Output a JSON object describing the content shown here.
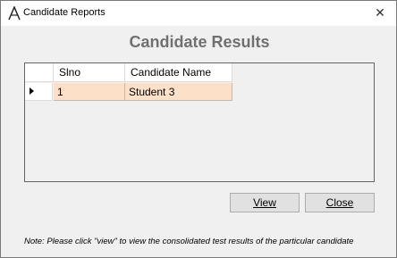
{
  "window": {
    "title": "Candidate Reports",
    "close_glyph": "✕",
    "icon": "app-logo-icon"
  },
  "heading": "Candidate Results",
  "grid": {
    "columns": [
      "Slno",
      "Candidate Name"
    ],
    "rows": [
      {
        "slno": "1",
        "name": "Student 3",
        "selected": true
      }
    ],
    "selected_row_color": "#fde0c8"
  },
  "buttons": {
    "view": "View",
    "close": "Close"
  },
  "note": "Note: Please click \"view\" to view the consolidated test results of the particular candidate"
}
